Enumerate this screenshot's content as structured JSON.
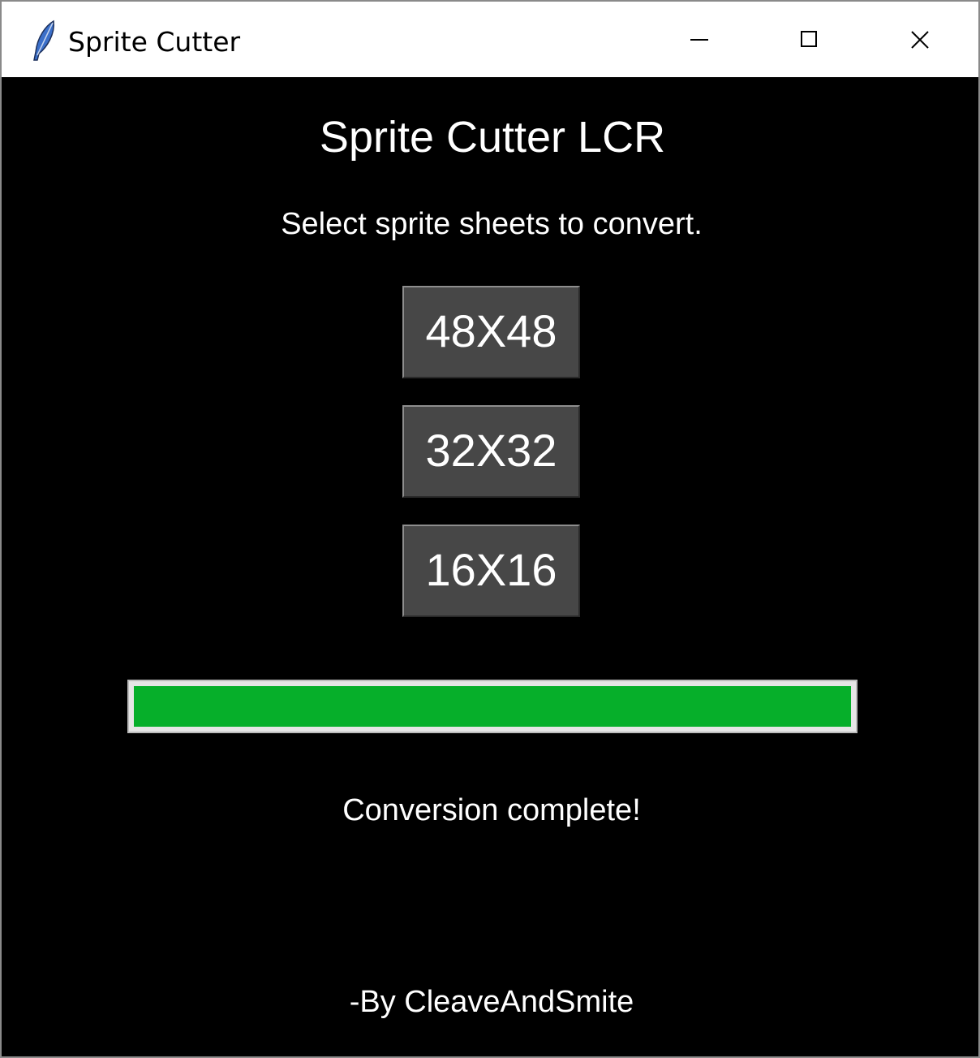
{
  "window": {
    "title": "Sprite Cutter",
    "icon": "feather-icon",
    "controls": {
      "minimize": "minimize-icon",
      "maximize": "maximize-icon",
      "close": "close-icon"
    }
  },
  "app": {
    "heading": "Sprite Cutter LCR",
    "subtitle": "Select sprite sheets to convert.",
    "buttons": [
      {
        "label": "48X48"
      },
      {
        "label": "32X32"
      },
      {
        "label": "16X16"
      }
    ],
    "progress": {
      "value": 1.0,
      "fill_color": "#06af2a"
    },
    "status": "Conversion complete!",
    "credit": "-By CleaveAndSmite"
  },
  "colors": {
    "background": "#000000",
    "button_bg": "#474747",
    "text": "#ffffff"
  }
}
